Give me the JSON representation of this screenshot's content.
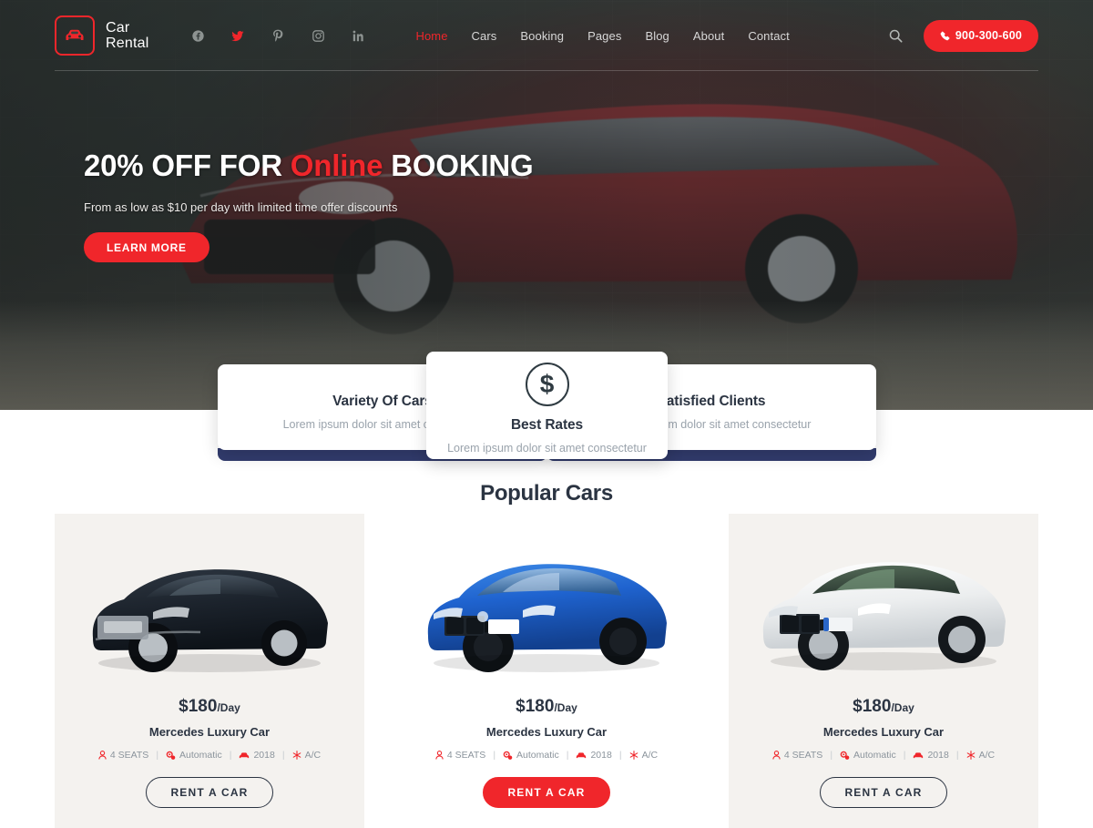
{
  "header": {
    "logo": {
      "icon": "car-icon",
      "line1": "Car",
      "line2": "Rental"
    },
    "socials": [
      {
        "name": "facebook-icon",
        "label": "f",
        "active": false
      },
      {
        "name": "twitter-icon",
        "label": "t",
        "active": true
      },
      {
        "name": "pinterest-icon",
        "label": "p",
        "active": false
      },
      {
        "name": "instagram-icon",
        "label": "i",
        "active": false
      },
      {
        "name": "linkedin-icon",
        "label": "in",
        "active": false
      }
    ],
    "nav": [
      {
        "label": "Home",
        "active": true
      },
      {
        "label": "Cars",
        "active": false
      },
      {
        "label": "Booking",
        "active": false
      },
      {
        "label": "Pages",
        "active": false
      },
      {
        "label": "Blog",
        "active": false
      },
      {
        "label": "About",
        "active": false
      },
      {
        "label": "Contact",
        "active": false
      }
    ],
    "search_icon": "search-icon",
    "phone": {
      "icon": "phone-icon",
      "number": "900-300-600"
    }
  },
  "hero": {
    "title_pre": "20% OFF FOR ",
    "title_accent": "Online",
    "title_post": " BOOKING",
    "subtitle": "From as low as $10 per day with limited time offer discounts",
    "cta": "LEARN MORE"
  },
  "features": [
    {
      "title": "Variety Of Cars",
      "desc": "Lorem ipsum dolor sit amet consectetur",
      "icon": ""
    },
    {
      "title": "Best Rates",
      "desc": "Lorem ipsum dolor sit amet consectetur",
      "icon": "dollar-icon"
    },
    {
      "title": "Satisfied Clients",
      "desc": "Lorem ipsum dolor sit amet consectetur",
      "icon": ""
    }
  ],
  "popular": {
    "title": "Popular Cars",
    "cars": [
      {
        "image": "black-audi-sedan",
        "price": "$180",
        "per": "/Day",
        "name": "Mercedes Luxury Car",
        "specs": [
          {
            "icon": "seat-icon",
            "label": "4 SEATS"
          },
          {
            "icon": "gears-icon",
            "label": "Automatic"
          },
          {
            "icon": "car-icon",
            "label": "2018"
          },
          {
            "icon": "snowflake-icon",
            "label": "A/C"
          }
        ],
        "cta": "RENT A CAR",
        "cta_filled": false
      },
      {
        "image": "blue-bmw-sedan",
        "price": "$180",
        "per": "/Day",
        "name": "Mercedes Luxury Car",
        "specs": [
          {
            "icon": "seat-icon",
            "label": "4 SEATS"
          },
          {
            "icon": "gears-icon",
            "label": "Automatic"
          },
          {
            "icon": "car-icon",
            "label": "2018"
          },
          {
            "icon": "snowflake-icon",
            "label": "A/C"
          }
        ],
        "cta": "RENT A CAR",
        "cta_filled": true
      },
      {
        "image": "white-bmw-sedan",
        "price": "$180",
        "per": "/Day",
        "name": "Mercedes Luxury Car",
        "specs": [
          {
            "icon": "seat-icon",
            "label": "4 SEATS"
          },
          {
            "icon": "gears-icon",
            "label": "Automatic"
          },
          {
            "icon": "car-icon",
            "label": "2018"
          },
          {
            "icon": "snowflake-icon",
            "label": "A/C"
          }
        ],
        "cta": "RENT A CAR",
        "cta_filled": false
      }
    ]
  },
  "colors": {
    "accent": "#f0262b",
    "dark": "#2b3442",
    "navy_bar": "#323c6e",
    "card_bg": "#f4f2ef",
    "muted": "#9aa3ac"
  }
}
